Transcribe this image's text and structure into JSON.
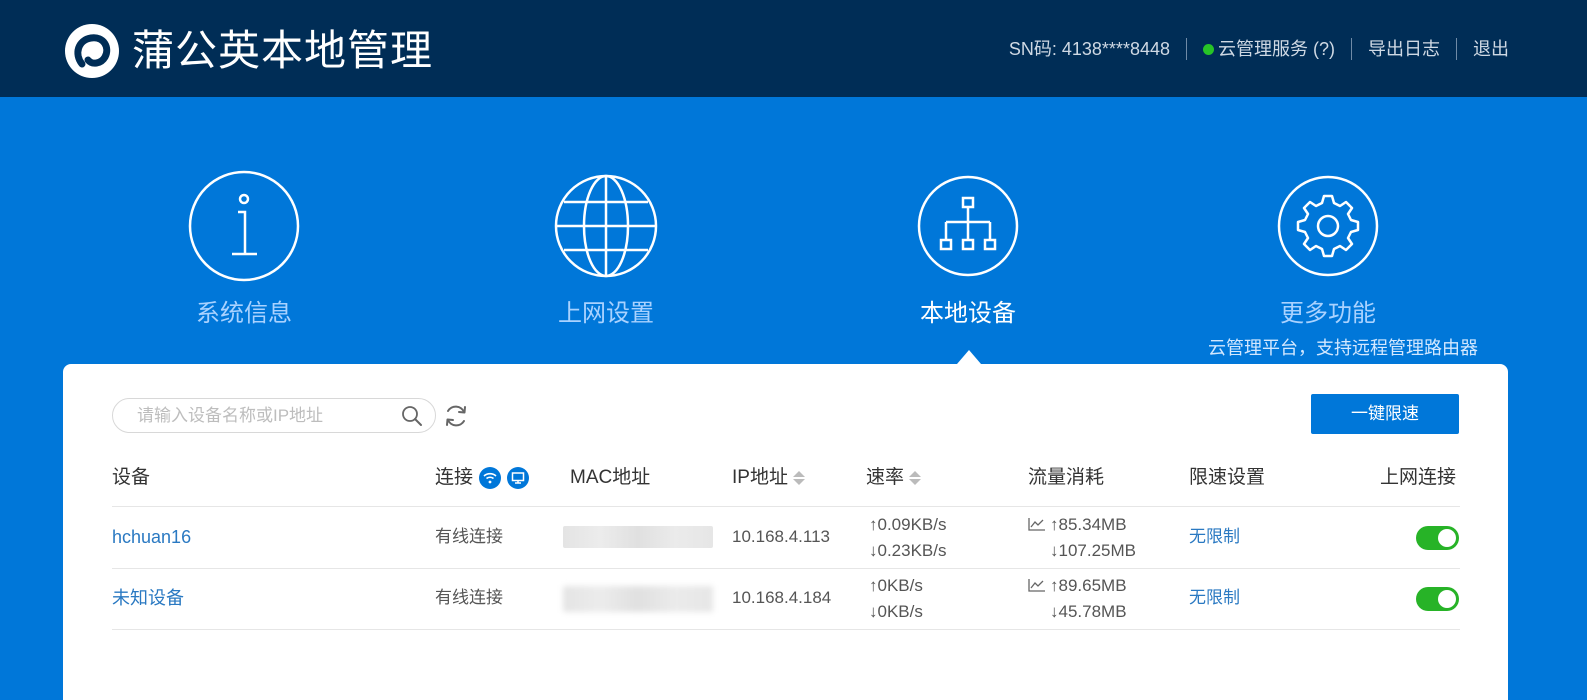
{
  "header": {
    "title": "蒲公英本地管理",
    "sn_text": "SN码: 4138****8448",
    "cloud_service": "云管理服务 (?)",
    "export_log": "导出日志",
    "logout": "退出",
    "cloud_status_color": "#27c427"
  },
  "features": [
    {
      "label": "系统信息",
      "icon": "info-icon"
    },
    {
      "label": "上网设置",
      "icon": "globe-icon"
    },
    {
      "label": "本地设备",
      "icon": "network-tree-icon",
      "active": true
    },
    {
      "label": "更多功能",
      "icon": "gear-icon",
      "subtitle": "云管理平台，支持远程管理路由器"
    }
  ],
  "toolbar": {
    "search_placeholder": "请输入设备名称或IP地址",
    "limit_button": "一键限速"
  },
  "table": {
    "headers": {
      "device": "设备",
      "connection": "连接",
      "mac": "MAC地址",
      "ip": "IP地址",
      "speed": "速率",
      "traffic": "流量消耗",
      "limit": "限速设置",
      "online": "上网连接"
    },
    "rows": [
      {
        "name": "hchuan16",
        "connection": "有线连接",
        "ip": "10.168.4.113",
        "speed_up": "↑0.09KB/s",
        "speed_down": "↓0.23KB/s",
        "traffic_up": "↑85.34MB",
        "traffic_down": "↓107.25MB",
        "limit": "无限制",
        "online": true
      },
      {
        "name": "未知设备",
        "connection": "有线连接",
        "ip": "10.168.4.184",
        "speed_up": "↑0KB/s",
        "speed_down": "↓0KB/s",
        "traffic_up": "↑89.65MB",
        "traffic_down": "↓45.78MB",
        "limit": "无限制",
        "online": true
      }
    ]
  },
  "colors": {
    "header_bg": "#002d56",
    "primary": "#0077d9",
    "link": "#2a79c2",
    "toggle_on": "#27b327"
  }
}
